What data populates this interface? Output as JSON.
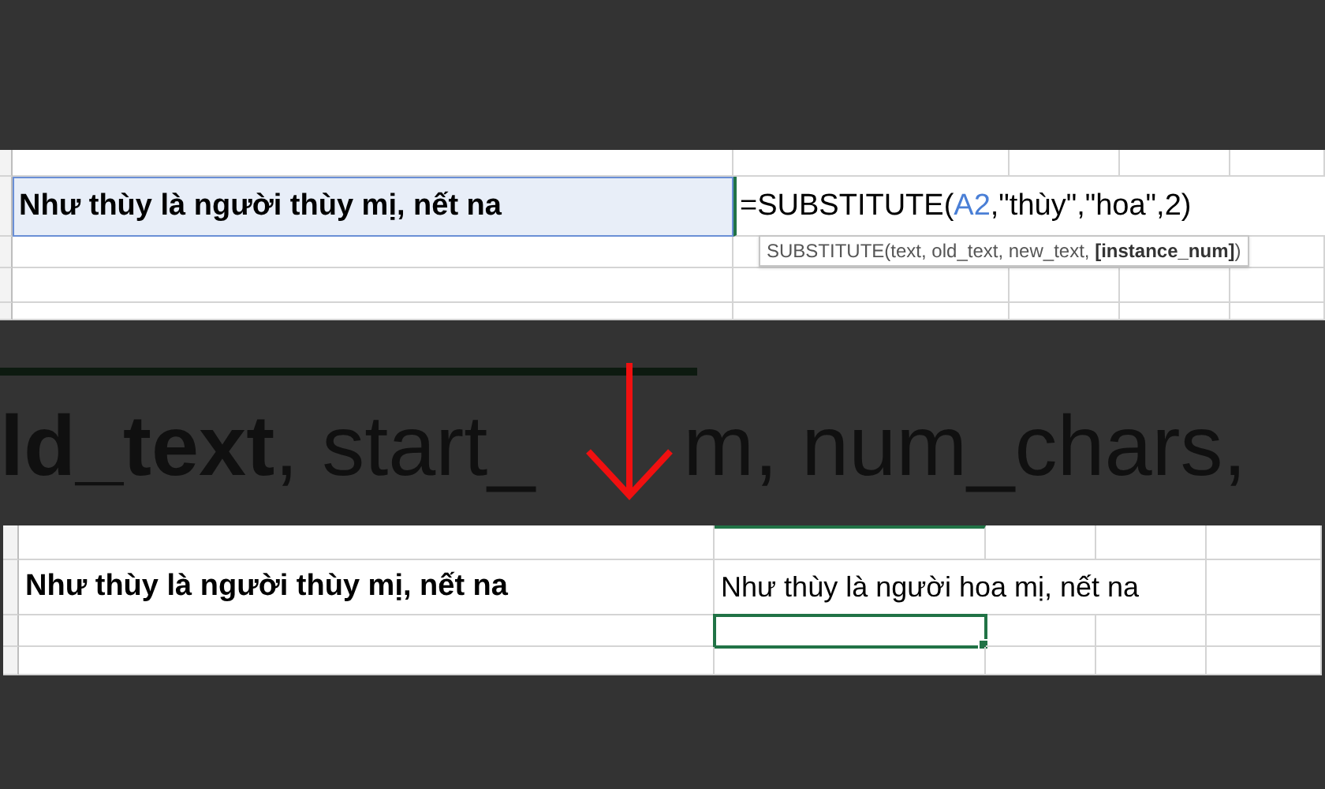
{
  "top_sheet": {
    "source_cell": {
      "text": "Như thùy là người thùy mị, nết na",
      "selected": true
    },
    "formula": [
      {
        "kind": "text",
        "text": "=SUBSTITUTE("
      },
      {
        "kind": "ref",
        "text": "A2"
      },
      {
        "kind": "text",
        "text": ",\"thùy\",\"hoa\",2)"
      }
    ],
    "tooltip": "SUBSTITUTE(text, old_text, new_text, **[instance_num]**)"
  },
  "background_text": [
    "**ld_text**, start_",
    "m, num_chars,"
  ],
  "bottom_sheet": {
    "source_cell": "Như thùy là người thùy mị, nết na",
    "result_cell": "Như thùy là người hoa mị, nết na",
    "empty_cell": {
      "selected": true
    }
  }
}
